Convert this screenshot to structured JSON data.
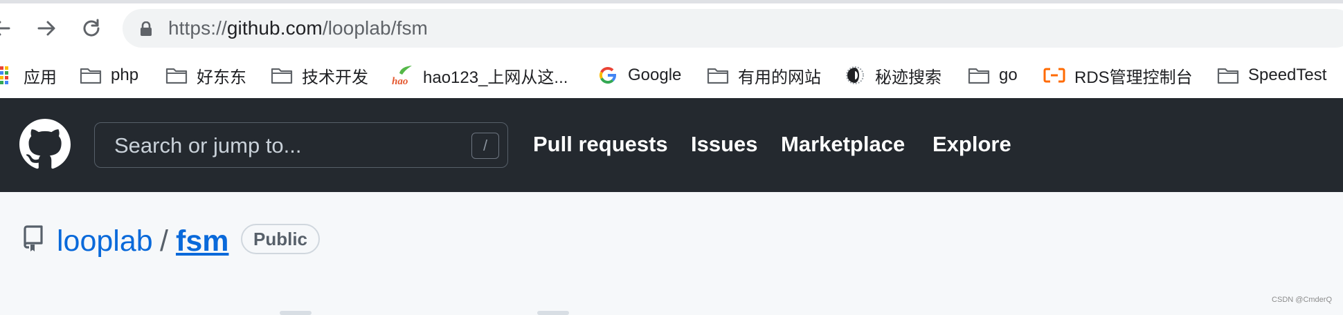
{
  "browser": {
    "url": {
      "scheme": "https://",
      "host": "github.com",
      "path": "/looplab/fsm"
    },
    "bookmarks": [
      {
        "label": "应用",
        "icon": "apps-grid-icon"
      },
      {
        "label": "php",
        "icon": "folder-icon"
      },
      {
        "label": "好东东",
        "icon": "folder-icon"
      },
      {
        "label": "技术开发",
        "icon": "folder-icon"
      },
      {
        "label": "hao123_上网从这...",
        "icon": "hao123-icon"
      },
      {
        "label": "Google",
        "icon": "google-icon"
      },
      {
        "label": "有用的网站",
        "icon": "folder-icon"
      },
      {
        "label": "秘迹搜索",
        "icon": "miji-icon"
      },
      {
        "label": "go",
        "icon": "folder-icon"
      },
      {
        "label": "RDS管理控制台",
        "icon": "aliyun-icon"
      },
      {
        "label": "SpeedTest",
        "icon": "folder-icon"
      }
    ]
  },
  "github_header": {
    "search_placeholder": "Search or jump to...",
    "search_shortcut": "/",
    "nav": [
      "Pull requests",
      "Issues",
      "Marketplace",
      "Explore"
    ]
  },
  "repo": {
    "owner": "looplab",
    "separator": "/",
    "name": "fsm",
    "visibility": "Public"
  },
  "watermark": "CSDN @CmderQ",
  "colors": {
    "github_header_bg": "#24292f",
    "link_blue": "#0969da",
    "page_bg": "#f6f8fa"
  }
}
